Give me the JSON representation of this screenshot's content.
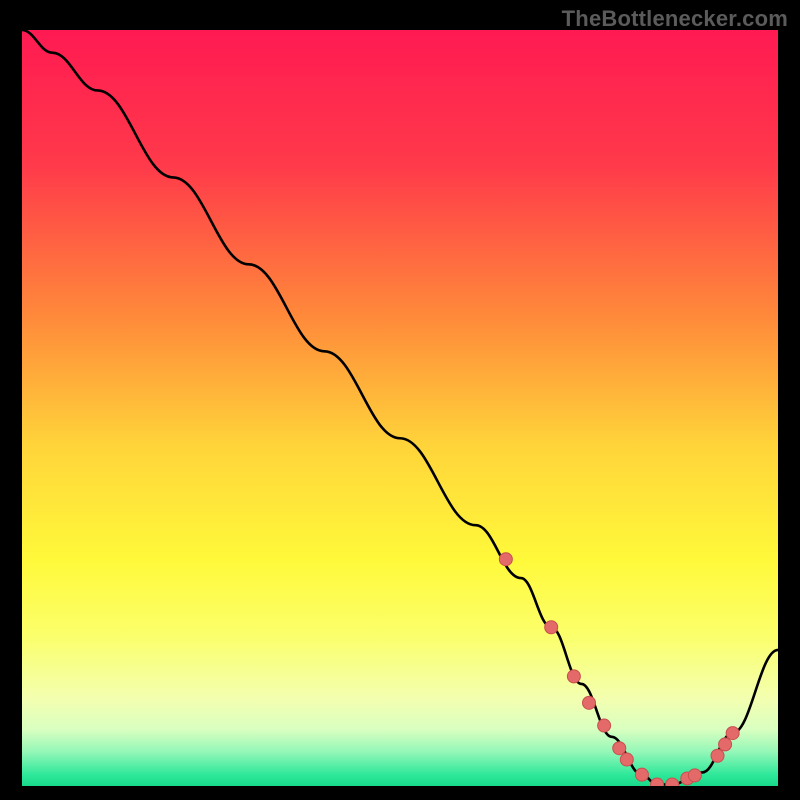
{
  "watermark": {
    "text": "TheBottlenecker.com"
  },
  "chart_data": {
    "type": "line",
    "title": "",
    "xlabel": "",
    "ylabel": "",
    "xlim": [
      0,
      100
    ],
    "ylim": [
      0,
      100
    ],
    "x": [
      0,
      4,
      10,
      20,
      30,
      40,
      50,
      60,
      66,
      70,
      74,
      78,
      82,
      84,
      86,
      90,
      94,
      100
    ],
    "y": [
      100,
      97,
      92,
      80.5,
      69,
      57.5,
      46,
      34.5,
      27.5,
      21,
      13.5,
      6.5,
      1.5,
      0.2,
      0.2,
      1.8,
      7,
      18
    ],
    "markers": {
      "x": [
        64,
        70,
        73,
        75,
        77,
        79,
        80,
        82,
        84,
        86,
        88,
        89,
        92,
        93,
        94
      ],
      "y": [
        30,
        21,
        14.5,
        11,
        8,
        5,
        3.5,
        1.5,
        0.2,
        0.2,
        1,
        1.4,
        4,
        5.5,
        7
      ]
    },
    "background_gradient": {
      "stops": [
        {
          "offset": 0.0,
          "color": "#ff1a52"
        },
        {
          "offset": 0.18,
          "color": "#ff3a4a"
        },
        {
          "offset": 0.38,
          "color": "#ff8a3a"
        },
        {
          "offset": 0.55,
          "color": "#ffd43a"
        },
        {
          "offset": 0.7,
          "color": "#fff93a"
        },
        {
          "offset": 0.8,
          "color": "#fbff6a"
        },
        {
          "offset": 0.885,
          "color": "#f3ffb0"
        },
        {
          "offset": 0.925,
          "color": "#d9ffc0"
        },
        {
          "offset": 0.955,
          "color": "#93f7b8"
        },
        {
          "offset": 0.985,
          "color": "#2fe89a"
        },
        {
          "offset": 1.0,
          "color": "#18d98a"
        }
      ]
    },
    "colors": {
      "line": "#000000",
      "marker_fill": "#e46a6a",
      "marker_stroke": "#c94f4f"
    }
  }
}
